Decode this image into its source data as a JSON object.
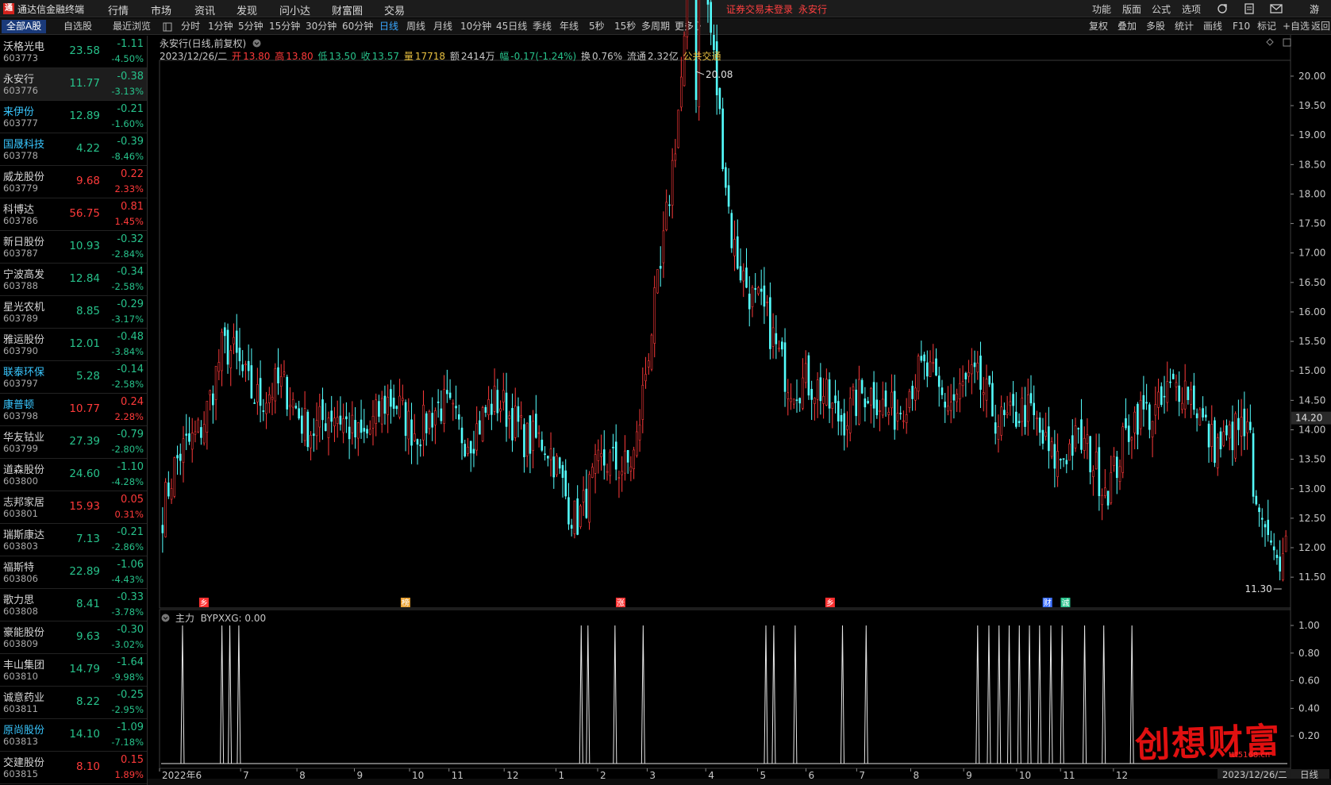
{
  "app": {
    "title": "通达信金融终端",
    "logo_glyph": "通"
  },
  "menu": [
    "行情",
    "市场",
    "资讯",
    "发现",
    "问小达",
    "财富圈",
    "交易"
  ],
  "warning": {
    "text": "证券交易未登录",
    "stock": "永安行"
  },
  "menu_right": [
    "功能",
    "版面",
    "公式",
    "选项"
  ],
  "menu_right_icons": [
    "refresh-icon",
    "document-icon",
    "mail-icon"
  ],
  "list_tabs": [
    "全部A股",
    "自选股",
    "最近浏览"
  ],
  "periods": [
    "分时",
    "1分钟",
    "5分钟",
    "15分钟",
    "30分钟",
    "60分钟",
    "日线",
    "周线",
    "月线",
    "10分钟",
    "45日线",
    "季线",
    "年线",
    "5秒",
    "15秒",
    "多周期",
    "更多 〉"
  ],
  "active_period": "日线",
  "toolbar_right": [
    "复权",
    "叠加",
    "多股",
    "统计",
    "画线",
    "F10",
    "标记",
    "+自选",
    "返回"
  ],
  "stocks": [
    {
      "name": "沃格光电",
      "code": "603773",
      "price": "23.58",
      "chg": "-1.11",
      "pct": "-4.50%",
      "dir": "dn",
      "hl": false
    },
    {
      "name": "永安行",
      "code": "603776",
      "price": "11.77",
      "chg": "-0.38",
      "pct": "-3.13%",
      "dir": "dn",
      "hl": false,
      "sel": true
    },
    {
      "name": "来伊份",
      "code": "603777",
      "price": "12.89",
      "chg": "-0.21",
      "pct": "-1.60%",
      "dir": "dn",
      "hl": true
    },
    {
      "name": "国晟科技",
      "code": "603778",
      "price": "4.22",
      "chg": "-0.39",
      "pct": "-8.46%",
      "dir": "dn",
      "hl": true
    },
    {
      "name": "威龙股份",
      "code": "603779",
      "price": "9.68",
      "chg": "0.22",
      "pct": "2.33%",
      "dir": "up",
      "hl": false
    },
    {
      "name": "科博达",
      "code": "603786",
      "price": "56.75",
      "chg": "0.81",
      "pct": "1.45%",
      "dir": "up",
      "hl": false
    },
    {
      "name": "新日股份",
      "code": "603787",
      "price": "10.93",
      "chg": "-0.32",
      "pct": "-2.84%",
      "dir": "dn",
      "hl": false
    },
    {
      "name": "宁波高发",
      "code": "603788",
      "price": "12.84",
      "chg": "-0.34",
      "pct": "-2.58%",
      "dir": "dn",
      "hl": false
    },
    {
      "name": "星光农机",
      "code": "603789",
      "price": "8.85",
      "chg": "-0.29",
      "pct": "-3.17%",
      "dir": "dn",
      "hl": false
    },
    {
      "name": "雅运股份",
      "code": "603790",
      "price": "12.01",
      "chg": "-0.48",
      "pct": "-3.84%",
      "dir": "dn",
      "hl": false
    },
    {
      "name": "联泰环保",
      "code": "603797",
      "price": "5.28",
      "chg": "-0.14",
      "pct": "-2.58%",
      "dir": "dn",
      "hl": true
    },
    {
      "name": "康普顿",
      "code": "603798",
      "price": "10.77",
      "chg": "0.24",
      "pct": "2.28%",
      "dir": "up",
      "hl": true
    },
    {
      "name": "华友钴业",
      "code": "603799",
      "price": "27.39",
      "chg": "-0.79",
      "pct": "-2.80%",
      "dir": "dn",
      "hl": false
    },
    {
      "name": "道森股份",
      "code": "603800",
      "price": "24.60",
      "chg": "-1.10",
      "pct": "-4.28%",
      "dir": "dn",
      "hl": false
    },
    {
      "name": "志邦家居",
      "code": "603801",
      "price": "15.93",
      "chg": "0.05",
      "pct": "0.31%",
      "dir": "up",
      "hl": false
    },
    {
      "name": "瑞斯康达",
      "code": "603803",
      "price": "7.13",
      "chg": "-0.21",
      "pct": "-2.86%",
      "dir": "dn",
      "hl": false
    },
    {
      "name": "福斯特",
      "code": "603806",
      "price": "22.89",
      "chg": "-1.06",
      "pct": "-4.43%",
      "dir": "dn",
      "hl": false
    },
    {
      "name": "歌力思",
      "code": "603808",
      "price": "8.41",
      "chg": "-0.33",
      "pct": "-3.78%",
      "dir": "dn",
      "hl": false
    },
    {
      "name": "豪能股份",
      "code": "603809",
      "price": "9.63",
      "chg": "-0.30",
      "pct": "-3.02%",
      "dir": "dn",
      "hl": false
    },
    {
      "name": "丰山集团",
      "code": "603810",
      "price": "14.79",
      "chg": "-1.64",
      "pct": "-9.98%",
      "dir": "dn",
      "hl": false
    },
    {
      "name": "诚意药业",
      "code": "603811",
      "price": "8.22",
      "chg": "-0.25",
      "pct": "-2.95%",
      "dir": "dn",
      "hl": false
    },
    {
      "name": "原尚股份",
      "code": "603813",
      "price": "14.10",
      "chg": "-1.09",
      "pct": "-7.18%",
      "dir": "dn",
      "hl": true
    },
    {
      "name": "交建股份",
      "code": "603815",
      "price": "8.10",
      "chg": "0.15",
      "pct": "1.89%",
      "dir": "up",
      "hl": false
    }
  ],
  "chart": {
    "title": "永安行(日线,前复权)",
    "date": "2023/12/26/二",
    "open_label": "开",
    "open": "13.80",
    "high_label": "高",
    "high": "13.80",
    "low_label": "低",
    "low": "13.50",
    "close_label": "收",
    "close": "13.57",
    "vol_label": "量",
    "vol": "17718",
    "amt_label": "额",
    "amt": "2414万",
    "range_label": "幅",
    "range": "-0.17(-1.24%)",
    "turn_label": "换",
    "turn": "0.76%",
    "float_label": "流通",
    "float": "2.32亿",
    "sector": "公共交通",
    "max_label": "20.08",
    "min_label": "11.30",
    "cursor_price": "14.20",
    "sub_title": "主力",
    "sub_indicator": "BYPXXG: 0.00",
    "end_date": "2023/12/26/二",
    "period_box": "日线"
  },
  "chart_data": {
    "type": "candlestick",
    "main": {
      "y_ticks": [
        "20.00",
        "19.50",
        "19.00",
        "18.50",
        "18.00",
        "17.50",
        "17.00",
        "16.50",
        "16.00",
        "15.50",
        "15.00",
        "14.50",
        "14.00",
        "13.50",
        "13.00",
        "12.50",
        "12.00",
        "11.50"
      ],
      "ylim": [
        11.3,
        20.08
      ],
      "x_ticks": [
        "2022年6",
        "7",
        "8",
        "9",
        "10",
        "11",
        "12",
        "1",
        "2",
        "3",
        "4",
        "5",
        "6",
        "7",
        "8",
        "9",
        "10",
        "11",
        "12"
      ],
      "key_points": [
        {
          "x": "2022年6",
          "close": 12.6
        },
        {
          "x": "7",
          "close": 15.2
        },
        {
          "x": "8",
          "close": 14.5
        },
        {
          "x": "9",
          "close": 14.0
        },
        {
          "x": "10",
          "close": 14.3
        },
        {
          "x": "11",
          "close": 14.1
        },
        {
          "x": "12",
          "close": 14.3
        },
        {
          "x": "1",
          "close": 12.7
        },
        {
          "x": "2",
          "close": 13.8
        },
        {
          "x": "3",
          "close": 20.08
        },
        {
          "x": "4",
          "close": 16.0
        },
        {
          "x": "5",
          "close": 14.5
        },
        {
          "x": "6",
          "close": 14.4
        },
        {
          "x": "7",
          "close": 14.8
        },
        {
          "x": "8",
          "close": 14.5
        },
        {
          "x": "9",
          "close": 13.8
        },
        {
          "x": "10",
          "close": 13.3
        },
        {
          "x": "11",
          "close": 14.8
        },
        {
          "x": "12",
          "close": 13.8
        },
        {
          "x": "2023/12/26/二",
          "close": 13.57
        }
      ],
      "markers": [
        "乡",
        "榜",
        "涨",
        "乡",
        "财",
        "诚"
      ]
    },
    "sub": {
      "name": "BYPXXG",
      "y_ticks": [
        "1.00",
        "0.80",
        "0.60",
        "0.40",
        "0.20"
      ],
      "ylim": [
        0,
        1
      ]
    }
  },
  "watermark": {
    "text": "创想财富",
    "url": "ttt5168.cn"
  }
}
